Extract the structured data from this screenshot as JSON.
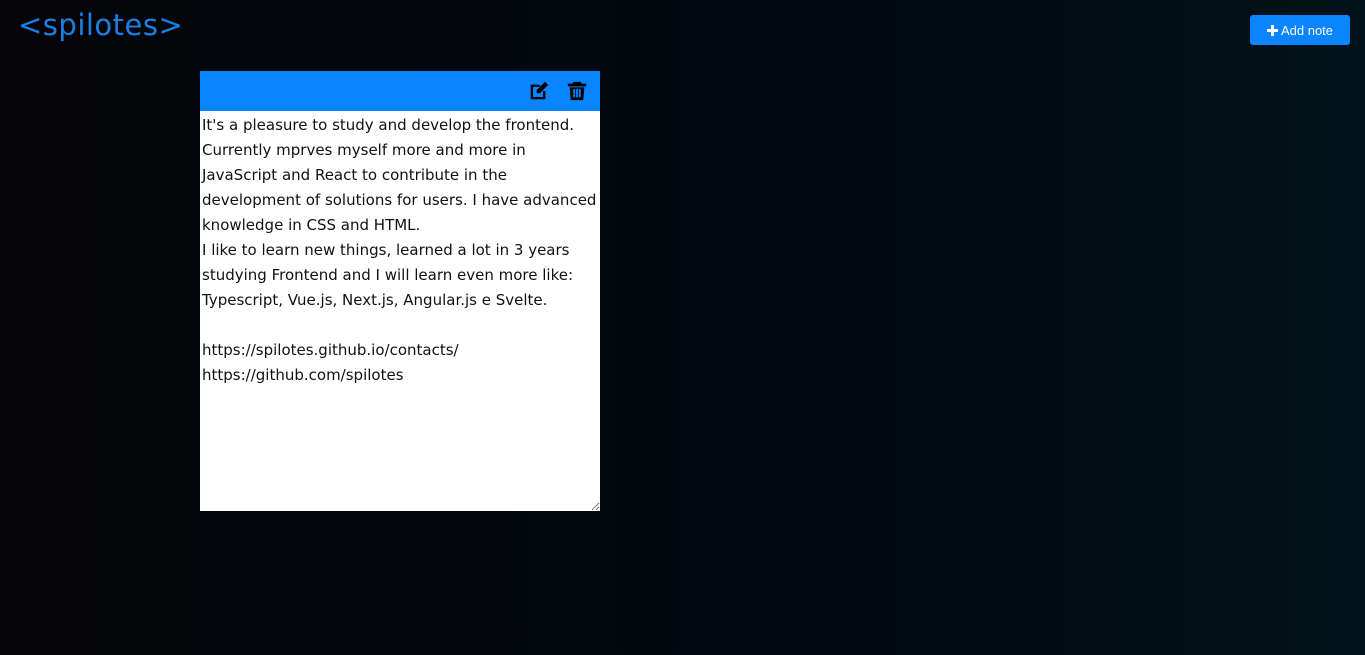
{
  "header": {
    "logo": "<spilotes>",
    "add_note_label": "Add note",
    "add_icon": "plus-icon"
  },
  "colors": {
    "accent": "#0a84ff",
    "logo": "#1a7fe0"
  },
  "notes": [
    {
      "icons": [
        "edit-icon",
        "trash-icon"
      ],
      "text": "It's a pleasure to study and develop the frontend. Currently mprves myself more and more in JavaScript and React to contribute in the development of solutions for users. I have advanced knowledge in CSS and HTML.\nI like to learn new things, learned a lot in 3 years studying Frontend and I will learn even more like: Typescript, Vue.js, Next.js, Angular.js e Svelte.\n\nhttps://spilotes.github.io/contacts/\nhttps://github.com/spilotes"
    }
  ]
}
